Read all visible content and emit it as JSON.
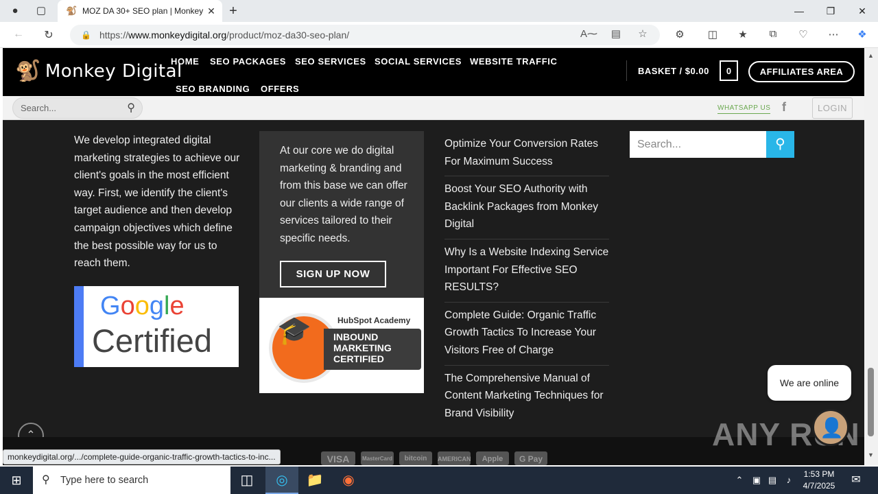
{
  "browser": {
    "tab_title": "MOZ DA 30+ SEO plan | Monkey",
    "url_prefix": "https://",
    "url_domain": "www.monkeydigital.org",
    "url_path": "/product/moz-da30-seo-plan/"
  },
  "site": {
    "logo_text": "Monkey Digital",
    "nav": [
      "HOME",
      "SEO PACKAGES",
      "SEO SERVICES",
      "SOCIAL SERVICES",
      "WEBSITE TRAFFIC",
      "SEO BRANDING",
      "OFFERS"
    ],
    "basket_label": "BASKET / $0.00",
    "basket_count": "0",
    "affiliates": "AFFILIATES AREA",
    "sub_search_placeholder": "Search...",
    "whatsapp": "WHATSAPP US",
    "login": "LOGIN"
  },
  "footer": {
    "about_text": "We develop integrated digital marketing strategies to achieve our client's goals in the most efficient way. First, we identify the client's target audience and then develop campaign objectives which define the best possible way for us to reach them.",
    "google_cert_1": "Google",
    "google_cert_2": "Certified",
    "core_text": "At our core we do digital marketing & branding and from this base we can offer our clients a wide range of services tailored to their specific needs.",
    "signup": "SIGN UP NOW",
    "hubspot_title": "HubSpot Academy",
    "hubspot_band": "INBOUND MARKETING CERTIFIED",
    "posts": [
      "Optimize Your Conversion Rates For Maximum Success",
      "Boost Your SEO Authority with Backlink Packages from Monkey Digital",
      "Why Is a Website Indexing Service Important For Effective SEO RESULTS?",
      "Complete Guide: Organic Traffic Growth Tactics To Increase Your Visitors Free of Charge",
      "The Comprehensive Manual of Content Marketing Techniques for Brand Visibility"
    ],
    "search_placeholder": "Search...",
    "chat_status": "We are online",
    "payments": [
      "VISA",
      "MasterCard",
      "bitcoin",
      "AMERICAN",
      "Apple Pay",
      "G Pay"
    ]
  },
  "status_url": "monkeydigital.org/.../complete-guide-organic-traffic-growth-tactics-to-inc...",
  "watermark": "ANY RUN",
  "taskbar": {
    "search_placeholder": "Type here to search",
    "time": "1:53 PM",
    "date": "4/7/2025"
  }
}
